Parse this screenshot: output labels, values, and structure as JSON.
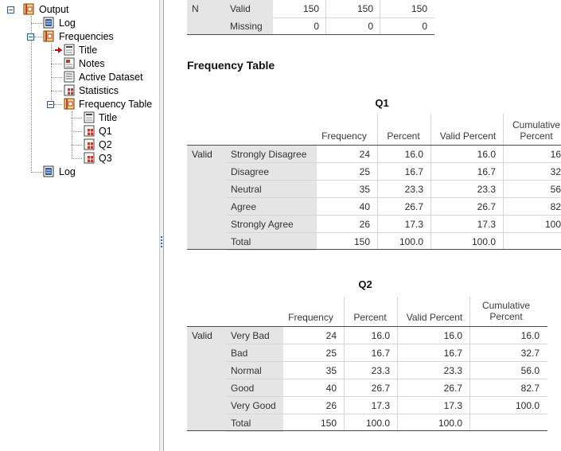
{
  "tree": {
    "nodes": [
      {
        "label": "Output",
        "icon": "output-book-icon"
      },
      {
        "label": "Log",
        "icon": "log-icon"
      },
      {
        "label": "Frequencies",
        "icon": "procedure-book-icon"
      },
      {
        "label": "Title",
        "icon": "title-icon"
      },
      {
        "label": "Notes",
        "icon": "notes-icon"
      },
      {
        "label": "Active Dataset",
        "icon": "dataset-icon"
      },
      {
        "label": "Statistics",
        "icon": "table-icon"
      },
      {
        "label": "Frequency Table",
        "icon": "procedure-book-icon"
      },
      {
        "label": "Title",
        "icon": "title-icon"
      },
      {
        "label": "Q1",
        "icon": "table-icon"
      },
      {
        "label": "Q2",
        "icon": "table-icon"
      },
      {
        "label": "Q3",
        "icon": "table-icon"
      },
      {
        "label": "Log",
        "icon": "log-icon"
      }
    ]
  },
  "statistics_partial": {
    "row_label": "N",
    "rows": [
      {
        "label": "Valid",
        "values": [
          "150",
          "150",
          "150"
        ]
      },
      {
        "label": "Missing",
        "values": [
          "0",
          "0",
          "0"
        ]
      }
    ]
  },
  "frequency_table_heading": "Frequency Table",
  "q1": {
    "title": "Q1",
    "headers": [
      "Frequency",
      "Percent",
      "Valid Percent",
      "Cumulative Percent"
    ],
    "group_label": "Valid",
    "rows": [
      {
        "label": "Strongly Disagree",
        "freq": "24",
        "pct": "16.0",
        "vpct": "16.0",
        "cum": "16"
      },
      {
        "label": "Disagree",
        "freq": "25",
        "pct": "16.7",
        "vpct": "16.7",
        "cum": "32"
      },
      {
        "label": "Neutral",
        "freq": "35",
        "pct": "23.3",
        "vpct": "23.3",
        "cum": "56"
      },
      {
        "label": "Agree",
        "freq": "40",
        "pct": "26.7",
        "vpct": "26.7",
        "cum": "82"
      },
      {
        "label": "Strongly Agree",
        "freq": "26",
        "pct": "17.3",
        "vpct": "17.3",
        "cum": "100"
      },
      {
        "label": "Total",
        "freq": "150",
        "pct": "100.0",
        "vpct": "100.0",
        "cum": ""
      }
    ]
  },
  "q2": {
    "title": "Q2",
    "headers": [
      "Frequency",
      "Percent",
      "Valid Percent",
      "Cumulative Percent"
    ],
    "group_label": "Valid",
    "rows": [
      {
        "label": "Very Bad",
        "freq": "24",
        "pct": "16.0",
        "vpct": "16.0",
        "cum": "16.0"
      },
      {
        "label": "Bad",
        "freq": "25",
        "pct": "16.7",
        "vpct": "16.7",
        "cum": "32.7"
      },
      {
        "label": "Normal",
        "freq": "35",
        "pct": "23.3",
        "vpct": "23.3",
        "cum": "56.0"
      },
      {
        "label": "Good",
        "freq": "40",
        "pct": "26.7",
        "vpct": "26.7",
        "cum": "82.7"
      },
      {
        "label": "Very Good",
        "freq": "26",
        "pct": "17.3",
        "vpct": "17.3",
        "cum": "100.0"
      },
      {
        "label": "Total",
        "freq": "150",
        "pct": "100.0",
        "vpct": "100.0",
        "cum": ""
      }
    ]
  }
}
